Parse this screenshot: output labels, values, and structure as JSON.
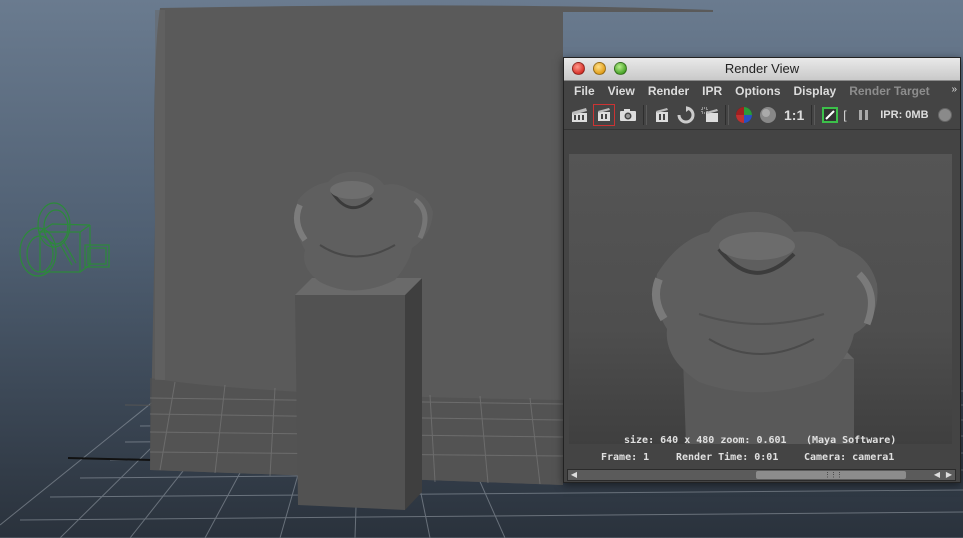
{
  "window": {
    "title": "Render View",
    "controls": [
      "close-button",
      "minimize-button",
      "zoom-button"
    ]
  },
  "menubar": {
    "items": [
      {
        "label": "File"
      },
      {
        "label": "View"
      },
      {
        "label": "Render"
      },
      {
        "label": "IPR"
      },
      {
        "label": "Options"
      },
      {
        "label": "Display"
      },
      {
        "label": "Render Target",
        "disabled": true
      }
    ],
    "overflow": "»"
  },
  "toolbar": {
    "icons": [
      "render-clapper-icon",
      "redo-render-icon",
      "snapshot-camera-icon",
      "ipr-clapper-icon",
      "refresh-ipr-icon",
      "render-region-icon",
      "rgb-channels-icon",
      "alpha-channel-icon",
      "keep-image-icon",
      "pause-icon",
      "ipr-indicator-icon"
    ],
    "ratio_label": "1:1",
    "bracket": "[",
    "ipr_label": "IPR: 0MB"
  },
  "status": {
    "size_zoom": "size: 640 x 480 zoom: 0.601",
    "renderer": "(Maya Software)",
    "frame": "Frame: 1",
    "render_time": "Render Time: 0:01",
    "camera": "Camera: camera1"
  },
  "colors": {
    "window_bg": "#444444",
    "titlebar": "#d6d6d6",
    "menu_text": "#dcdcdc",
    "viewport_bg_top": "#6a7b8f",
    "camera_wireframe": "#2c8a3a",
    "selected_outline": "#cc3333"
  }
}
